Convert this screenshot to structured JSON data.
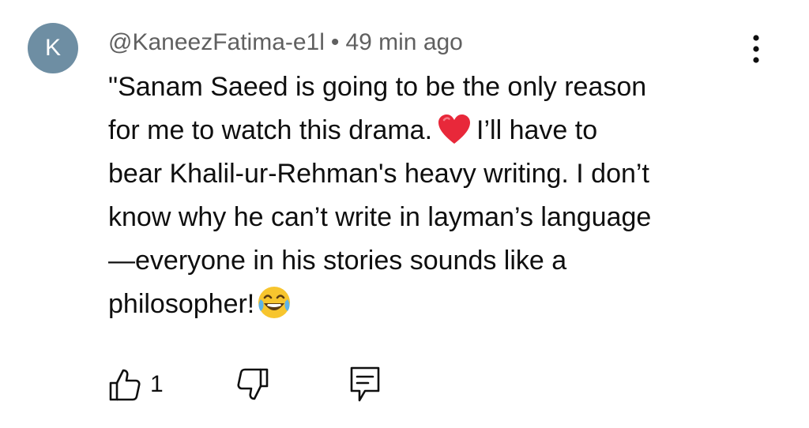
{
  "comment": {
    "avatar_letter": "K",
    "avatar_color": "#6e8ea3",
    "author": "@KaneezFatima-e1l",
    "separator": "•",
    "time": "49 min ago",
    "text_lines": {
      "l1": "\"Sanam Saeed is going to be the only reason",
      "l2a": "for me to watch this drama.",
      "l2b": "I’ll have to",
      "l3": "bear Khalil-ur-Rehman's heavy writing. I don’t",
      "l4": "know why he can’t write in layman’s language",
      "l5": "—everyone in his stories sounds like a",
      "l6": "philosopher!"
    },
    "emojis": [
      "red-heart",
      "face-with-tears-of-joy"
    ],
    "like_count": "1",
    "icons": {
      "more": "more-vertical-icon",
      "like": "thumbs-up-icon",
      "dislike": "thumbs-down-icon",
      "reply": "reply-comment-icon"
    }
  }
}
